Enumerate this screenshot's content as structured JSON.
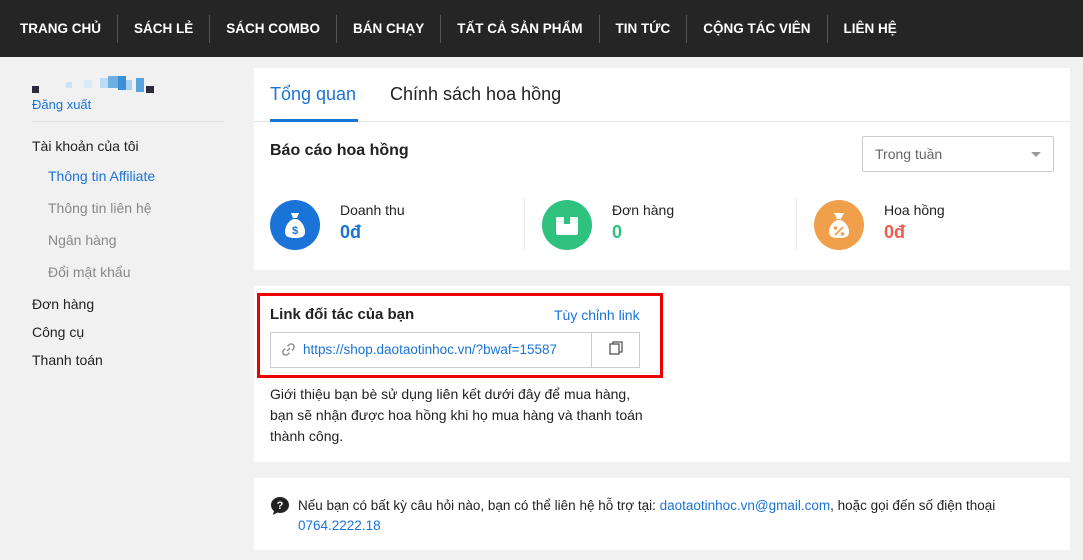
{
  "nav": {
    "items": [
      "TRANG CHỦ",
      "SÁCH LẺ",
      "SÁCH COMBO",
      "BÁN CHẠY",
      "TẤT CẢ SẢN PHẨM",
      "TIN TỨC",
      "CỘNG TÁC VIÊN",
      "LIÊN HỆ"
    ]
  },
  "sidebar": {
    "logout": "Đăng xuất",
    "my_account": "Tài khoản của tôi",
    "sub_items": [
      "Thông tin Affiliate",
      "Thông tin liên hệ",
      "Ngân hàng",
      "Đổi mật khẩu"
    ],
    "main_items": [
      "Đơn hàng",
      "Công cụ",
      "Thanh toán"
    ]
  },
  "tabs": [
    "Tổng quan",
    "Chính sách hoa hồng"
  ],
  "report": {
    "title": "Báo cáo hoa hồng",
    "period": "Trong tuần",
    "stats": [
      {
        "label": "Doanh thu",
        "value": "0đ",
        "color": "#1a73d6"
      },
      {
        "label": "Đơn hàng",
        "value": "0",
        "color": "#2ec27e"
      },
      {
        "label": "Hoa hồng",
        "value": "0đ",
        "color": "#f25a4a"
      }
    ]
  },
  "partner_link": {
    "title": "Link đối tác của bạn",
    "customize": "Tùy chỉnh link",
    "url": "https://shop.daotaotinhoc.vn/?bwaf=15587",
    "desc": "Giới thiệu bạn bè sử dụng liên kết dưới đây để mua hàng, bạn sẽ nhận được hoa hồng khi họ mua hàng và thanh toán thành công."
  },
  "contact": {
    "text_before": "Nếu bạn có bất kỳ câu hỏi nào, bạn có thể liên hệ hỗ trợ tại: ",
    "email": "daotaotinhoc.vn@gmail.com",
    "text_middle": ", hoặc gọi đến số điện thoại ",
    "phone": "0764.2222.18"
  },
  "colors": {
    "accent": "#1a73d6",
    "nav_bg": "#252525",
    "icon_blue": "#1a73d6",
    "icon_green": "#2ec27e",
    "icon_orange": "#f0a04b",
    "highlight": "#e00000"
  }
}
